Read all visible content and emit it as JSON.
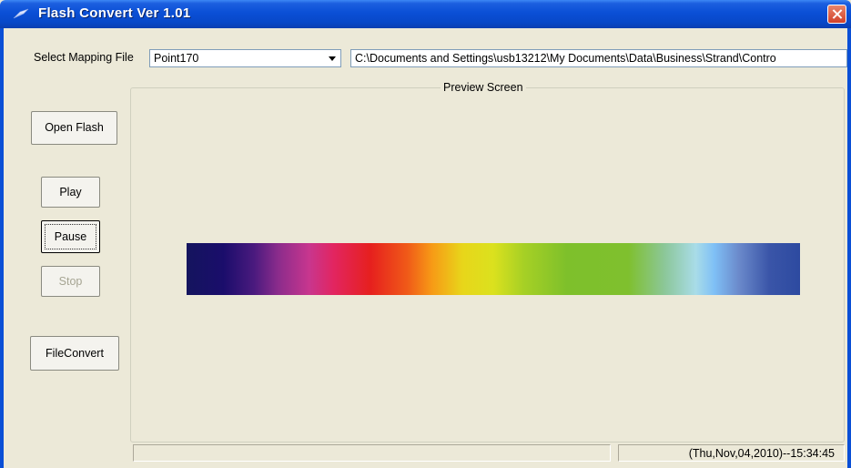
{
  "window": {
    "title": "Flash Convert Ver 1.01",
    "icons": {
      "app": "app-icon",
      "close": "close-icon"
    },
    "colors": {
      "titlebar": "#0a4fd6",
      "face": "#ece9d8"
    }
  },
  "mapping": {
    "label": "Select Mapping File",
    "selected": "Point170",
    "path": "C:\\Documents and Settings\\usb13212\\My Documents\\Data\\Business\\Strand\\Contro"
  },
  "preview": {
    "title": "Preview Screen"
  },
  "buttons": {
    "open_flash": "Open Flash",
    "play": "Play",
    "pause": "Pause",
    "stop": "Stop",
    "file_convert": "FileConvert"
  },
  "status": {
    "left": "",
    "timestamp": "(Thu,Nov,04,2010)--15:34:45"
  }
}
